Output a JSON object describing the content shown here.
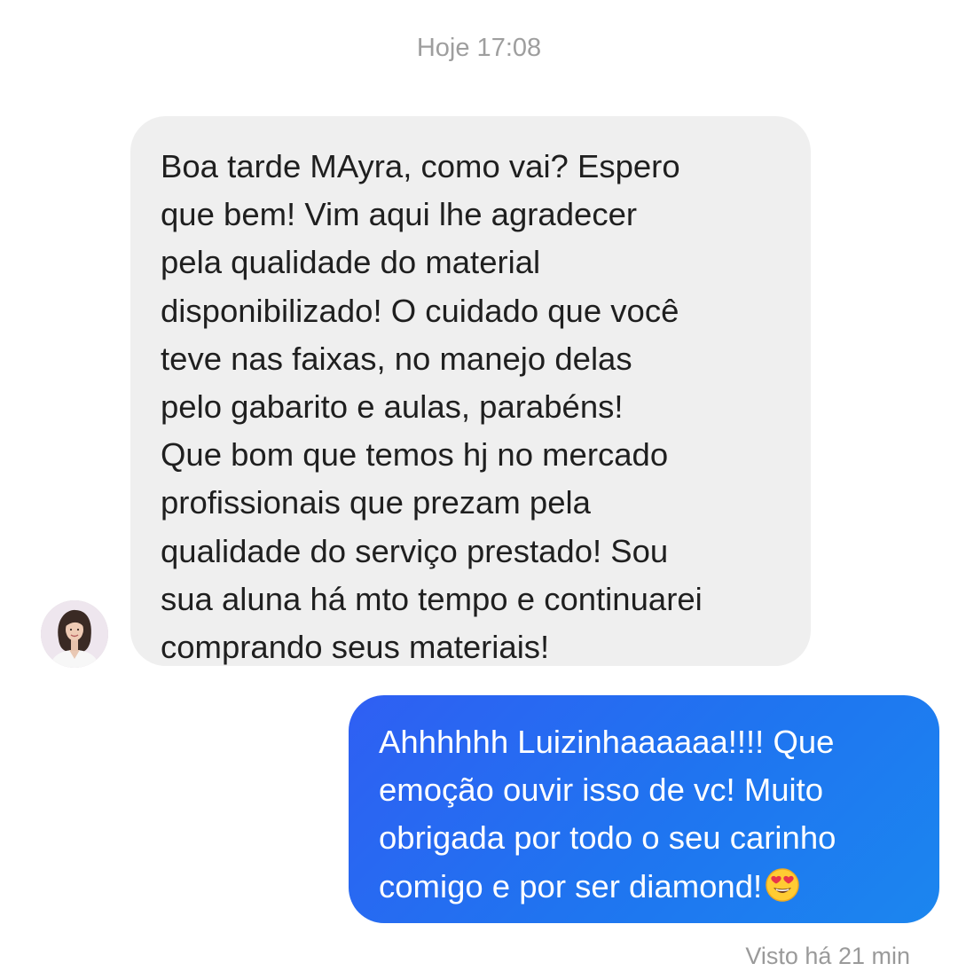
{
  "conversation": {
    "timestamp": "Hoje 17:08",
    "incoming_message": {
      "sender_avatar": "avatar",
      "bubble_color": "#efefef",
      "lines": [
        "Boa tarde MAyra, como vai? Espero",
        "que bem! Vim aqui lhe agradecer",
        "pela qualidade do material",
        "disponibilizado! O cuidado que você",
        "teve nas faixas, no manejo delas",
        "pelo gabarito e aulas, parabéns!",
        "Que bom que temos hj no mercado",
        "profissionais que prezam pela",
        "qualidade do serviço prestado! Sou",
        "sua aluna há mto tempo e continuarei",
        "comprando seus materiais!"
      ]
    },
    "outgoing_message": {
      "bubble_color": "#2f5ff3",
      "lines": [
        "Ahhhhhh Luizinhaaaaaa!!!! Que",
        "emoção ouvir isso de vc! Muito",
        "obrigada por todo o seu carinho",
        "comigo e por ser diamond!"
      ],
      "trailing_emoji": "heart-eyes-emoji"
    },
    "seen_status": "Visto há 21 min"
  }
}
